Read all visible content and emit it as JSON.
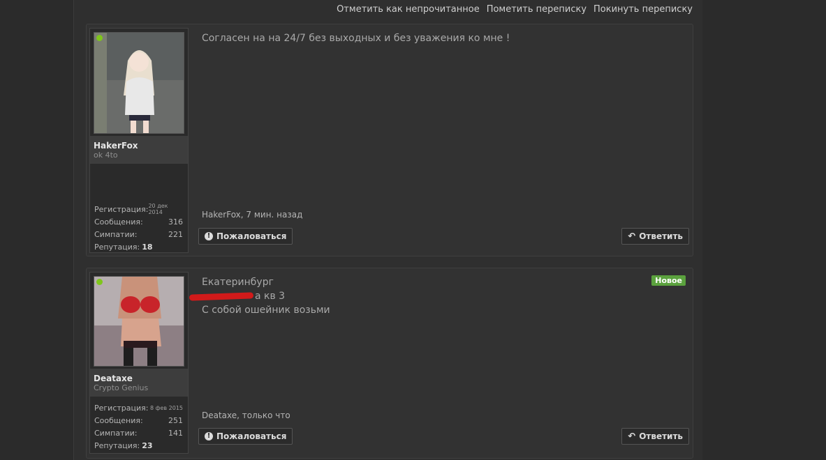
{
  "top_links": {
    "mark_unread": "Отметить как непрочитанное",
    "star_conversation": "Пометить переписку",
    "leave_conversation": "Покинуть переписку"
  },
  "messages": [
    {
      "username": "HakerFox",
      "user_title": "ok 4to",
      "stats": {
        "registration_label": "Регистрация:",
        "registration_value": "20 дек 2014",
        "posts_label": "Сообщения:",
        "posts_value": "316",
        "likes_label": "Симпатии:",
        "likes_value": "221",
        "reputation_label": "Репутация:",
        "reputation_value": "18"
      },
      "lines": [
        "Согласен на на 24/7 без выходных и без уважения ко мне !"
      ],
      "meta": "HakerFox, 7 мин. назад",
      "report_label": "Пожаловаться",
      "reply_label": "Ответить"
    },
    {
      "username": "Deataxe",
      "user_title": "Crypto Genius",
      "badge": "Новое",
      "stats": {
        "registration_label": "Регистрация:",
        "registration_value": "8 фев 2015",
        "posts_label": "Сообщения:",
        "posts_value": "251",
        "likes_label": "Симпатии:",
        "likes_value": "141",
        "reputation_label": "Репутация:",
        "reputation_value": "23"
      },
      "lines": [
        "Екатеринбург",
        "а кв 3",
        "С собой ошейник возьми"
      ],
      "meta": "Deataxe, только что",
      "report_label": "Пожаловаться",
      "reply_label": "Ответить"
    }
  ],
  "colors": {
    "online": "#7fc61b",
    "badge_new": "#5ba23e",
    "redaction": "#d11a1a"
  }
}
